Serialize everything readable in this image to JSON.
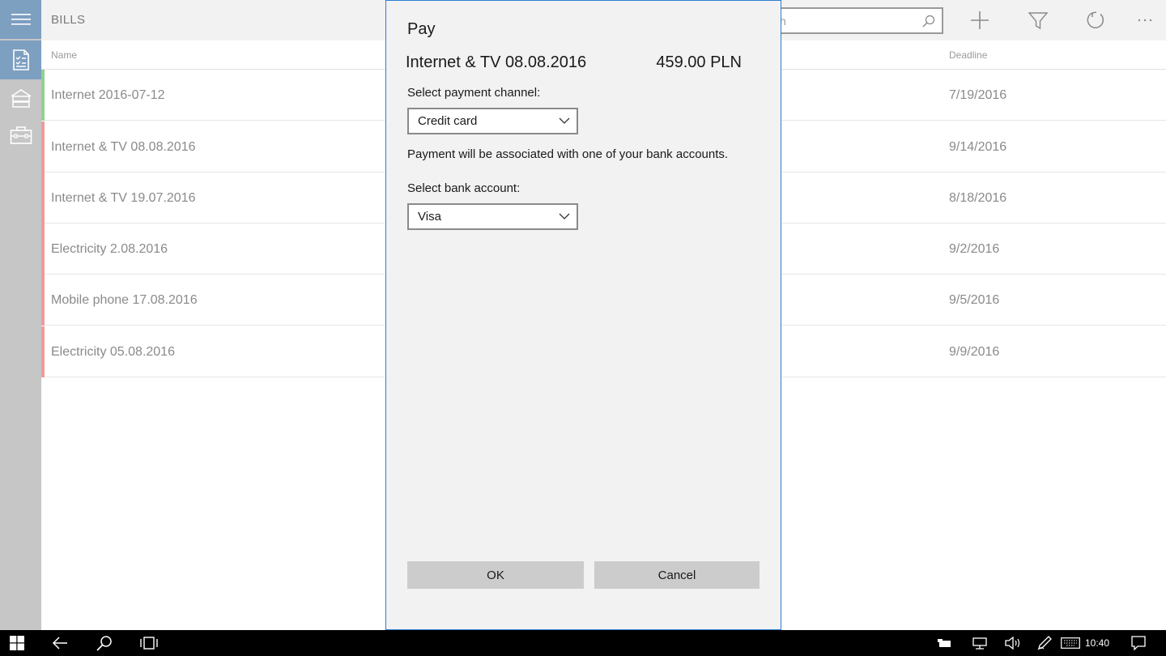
{
  "header": {
    "title": "BILLS",
    "search_placeholder": "h"
  },
  "columns": {
    "name": "Name",
    "deadline": "Deadline"
  },
  "bills": [
    {
      "name": "Internet 2016-07-12",
      "deadline": "7/19/2016",
      "status_color": "#8fd18f"
    },
    {
      "name": "Internet & TV 08.08.2016",
      "deadline": "9/14/2016",
      "status_color": "#f19a9a"
    },
    {
      "name": "Internet & TV 19.07.2016",
      "deadline": "8/18/2016",
      "status_color": "#f19a9a"
    },
    {
      "name": "Electricity 2.08.2016",
      "deadline": "9/2/2016",
      "status_color": "#f19a9a"
    },
    {
      "name": "Mobile phone 17.08.2016",
      "deadline": "9/5/2016",
      "status_color": "#f19a9a"
    },
    {
      "name": "Electricity 05.08.2016",
      "deadline": "9/9/2016",
      "status_color": "#f19a9a"
    }
  ],
  "dialog": {
    "title": "Pay",
    "bill_name": "Internet & TV 08.08.2016",
    "amount": "459.00 PLN",
    "channel_label": "Select payment channel:",
    "channel_value": "Credit card",
    "info_text": "Payment will be associated with one of your bank accounts.",
    "account_label": "Select bank account:",
    "account_value": "Visa",
    "ok_label": "OK",
    "cancel_label": "Cancel"
  },
  "taskbar": {
    "clock": "10:40"
  },
  "colors": {
    "accent": "#7d9fc0",
    "dialog_border": "#2d7dd2",
    "overdue": "#f19a9a",
    "paid": "#8fd18f"
  }
}
